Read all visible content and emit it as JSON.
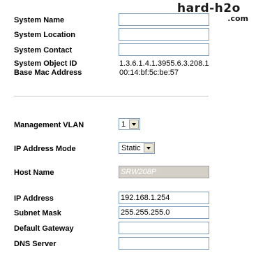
{
  "watermark": {
    "line1": "hard-h2o",
    "line2": ".com"
  },
  "system": {
    "name_label": "System Name",
    "name_value": "",
    "location_label": "System Location",
    "location_value": "",
    "contact_label": "System Contact",
    "contact_value": "",
    "object_id_label": "System Object ID",
    "object_id_value": "1.3.6.1.4.1.3955.6.3.208.1",
    "mac_label": "Base Mac Address",
    "mac_value": "00:14:bf:5c:be:57"
  },
  "network": {
    "vlan_label": "Management VLAN",
    "vlan_value": "1",
    "ip_mode_label": "IP Address Mode",
    "ip_mode_value": "Static",
    "host_label": "Host Name",
    "host_value": "SRW208P",
    "ip_label": "IP Address",
    "ip_value": "192.168.1.254",
    "mask_label": "Subnet Mask",
    "mask_value": "255.255.255.0",
    "gateway_label": "Default Gateway",
    "gateway_value": "",
    "dns_label": "DNS Server",
    "dns_value": ""
  }
}
